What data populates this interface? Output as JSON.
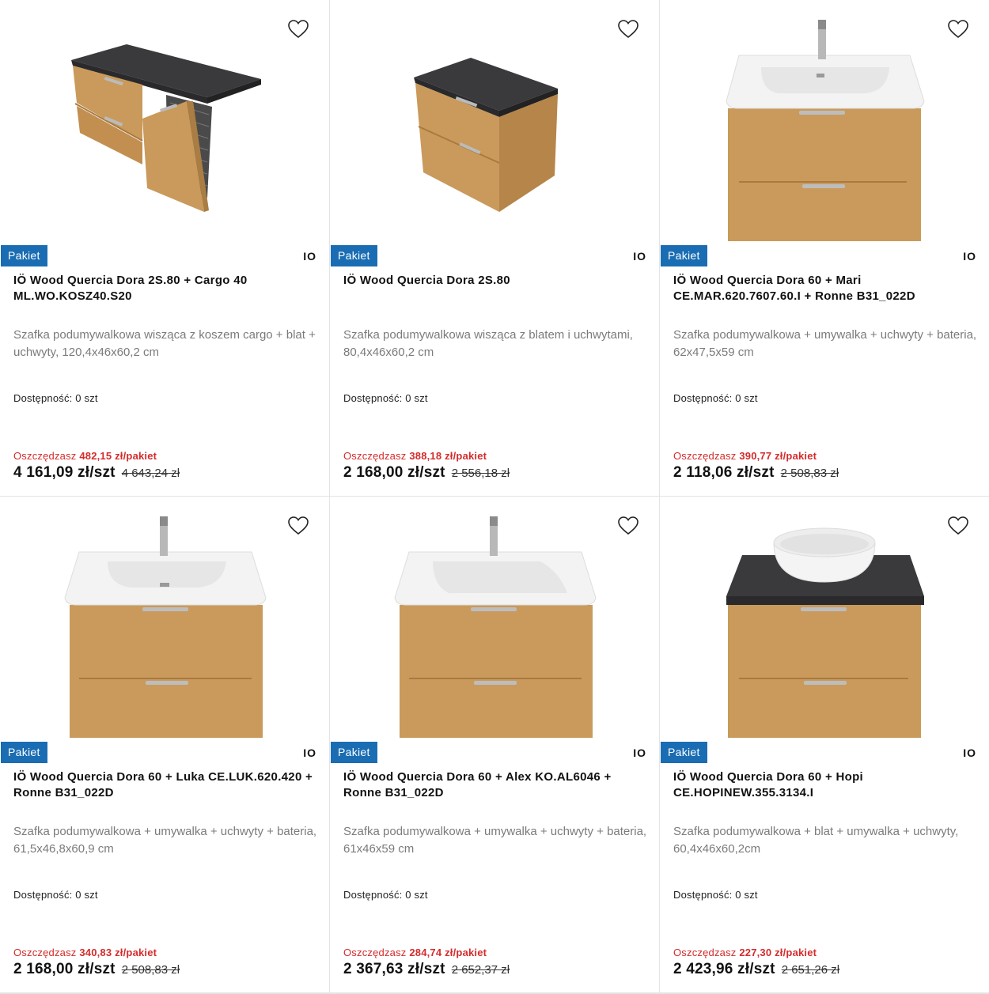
{
  "colors": {
    "badge": "#1a6db3",
    "savings": "#d52b2b",
    "oak": "#c99a5b",
    "top_black": "#3a3a3d",
    "ceramic": "#f4f4f4"
  },
  "products": [
    {
      "image": "cabinet-cargo-120",
      "badge": "Pakiet",
      "brand": "IO",
      "title": "IÖ Wood Quercia Dora 2S.80 + Cargo 40 ML.WO.KOSZ40.S20",
      "description": "Szafka podumywalkowa wisząca z koszem cargo + blat + uchwyty, 120,4x46x60,2 cm",
      "availability": "Dostępność: 0 szt",
      "savings_label": "Oszczędzasz",
      "savings_value": "482,15 zł/pakiet",
      "price": "4 161,09 zł/szt",
      "old_price": "4 643,24 zł"
    },
    {
      "image": "cabinet-2drawer-80",
      "badge": "Pakiet",
      "brand": "IO",
      "title": "IÖ Wood Quercia Dora 2S.80",
      "description": "Szafka podumywalkowa wisząca z blatem i uchwytami, 80,4x46x60,2 cm",
      "availability": "Dostępność: 0 szt",
      "savings_label": "Oszczędzasz",
      "savings_value": "388,18 zł/pakiet",
      "price": "2 168,00 zł/szt",
      "old_price": "2 556,18 zł"
    },
    {
      "image": "cabinet-basin-mari",
      "badge": "Pakiet",
      "brand": "IO",
      "title": "IÖ Wood Quercia Dora 60 + Mari CE.MAR.620.7607.60.I + Ronne B31_022D",
      "description": "Szafka podumywalkowa + umywalka + uchwyty + bateria, 62x47,5x59 cm",
      "availability": "Dostępność: 0 szt",
      "savings_label": "Oszczędzasz",
      "savings_value": "390,77 zł/pakiet",
      "price": "2 118,06 zł/szt",
      "old_price": "2 508,83 zł"
    },
    {
      "image": "cabinet-basin-luka",
      "badge": "Pakiet",
      "brand": "IO",
      "title": "IÖ Wood Quercia Dora 60 + Luka CE.LUK.620.420 + Ronne B31_022D",
      "description": "Szafka podumywalkowa + umywalka + uchwyty + bateria, 61,5x46,8x60,9 cm",
      "availability": "Dostępność: 0 szt",
      "savings_label": "Oszczędzasz",
      "savings_value": "340,83 zł/pakiet",
      "price": "2 168,00 zł/szt",
      "old_price": "2 508,83 zł"
    },
    {
      "image": "cabinet-basin-alex",
      "badge": "Pakiet",
      "brand": "IO",
      "title": "IÖ Wood Quercia Dora 60 + Alex KO.AL6046 + Ronne B31_022D",
      "description": "Szafka podumywalkowa + umywalka + uchwyty + bateria, 61x46x59 cm",
      "availability": "Dostępność: 0 szt",
      "savings_label": "Oszczędzasz",
      "savings_value": "284,74 zł/pakiet",
      "price": "2 367,63 zł/szt",
      "old_price": "2 652,37 zł"
    },
    {
      "image": "cabinet-bowl-hopi",
      "badge": "Pakiet",
      "brand": "IO",
      "title": "IÖ Wood Quercia Dora 60 + Hopi CE.HOPINEW.355.3134.I",
      "description": "Szafka podumywalkowa + blat + umywalka + uchwyty, 60,4x46x60,2cm",
      "availability": "Dostępność: 0 szt",
      "savings_label": "Oszczędzasz",
      "savings_value": "227,30 zł/pakiet",
      "price": "2 423,96 zł/szt",
      "old_price": "2 651,26 zł"
    }
  ]
}
